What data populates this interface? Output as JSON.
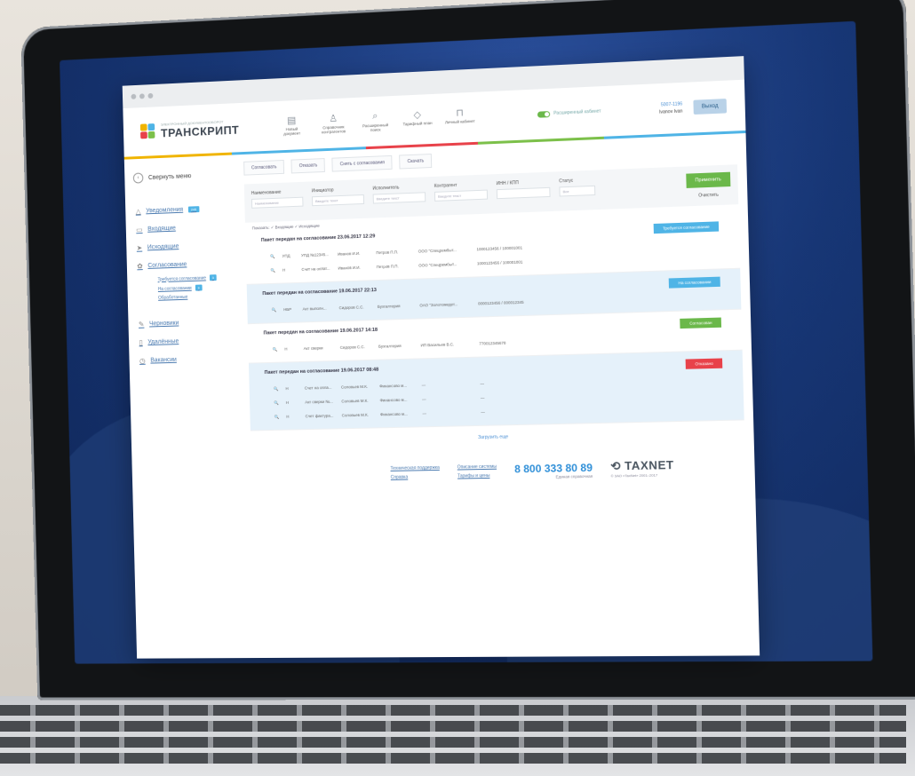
{
  "colors": {
    "accent": "#4fb4e6",
    "green": "#6bb84a",
    "red": "#e8424a"
  },
  "header": {
    "logo_tagline": "ЭЛЕКТРОННЫЙ ДОКУМЕНТООБОРОТ",
    "logo_title": "ТРАНСКРИПТ",
    "tools": [
      {
        "icon": "document-icon",
        "glyph": "▤",
        "label": "Новый документ"
      },
      {
        "icon": "user-icon",
        "glyph": "♙",
        "label": "Справочник контрагентов"
      },
      {
        "icon": "search-icon",
        "glyph": "⌕",
        "label": "Расширенный поиск"
      },
      {
        "icon": "tag-icon",
        "glyph": "◇",
        "label": "Тарифный план"
      },
      {
        "icon": "lock-icon",
        "glyph": "⊓",
        "label": "Личный кабинет"
      }
    ],
    "toggle_label": "Расширенный кабинет",
    "user_id": "5007-1196",
    "user_name": "Ivanov Ivan",
    "exit_label": "Выход"
  },
  "sidebar": {
    "collapse_label": "Свернуть меню",
    "items": [
      {
        "icon": "bell-icon",
        "glyph": "△",
        "label": "Уведомления",
        "badge": "245"
      },
      {
        "icon": "inbox-icon",
        "glyph": "▭",
        "label": "Входящие"
      },
      {
        "icon": "send-icon",
        "glyph": "➤",
        "label": "Исходящие"
      },
      {
        "icon": "gear-icon",
        "glyph": "✿",
        "label": "Согласование"
      }
    ],
    "sub": [
      {
        "label": "Требуется согласование",
        "badge": "3"
      },
      {
        "label": "На согласовании",
        "badge": "3"
      },
      {
        "label": "Обработанные"
      }
    ],
    "items2": [
      {
        "icon": "pen-icon",
        "glyph": "✎",
        "label": "Черновики"
      },
      {
        "icon": "trash-icon",
        "glyph": "▯",
        "label": "Удалённые"
      },
      {
        "icon": "clock-icon",
        "glyph": "◷",
        "label": "Вакансии"
      }
    ]
  },
  "actions": [
    "Согласовать",
    "Отказать",
    "Снять с согласования",
    "Скачать"
  ],
  "filters": {
    "columns": [
      {
        "label": "Наименование",
        "placeholder": "Наименование"
      },
      {
        "label": "Инициатор",
        "placeholder": "Введите текст"
      },
      {
        "label": "Исполнитель",
        "placeholder": "Введите текст"
      },
      {
        "label": "Контрагент",
        "placeholder": "Введите текст"
      },
      {
        "label": "ИНН / КПП",
        "placeholder": ""
      },
      {
        "label": "Статус",
        "placeholder": "Все"
      }
    ],
    "apply": "Применить",
    "clear": "Очистить",
    "show": "Показать:  ✓ Входящие  ✓ Исходящие"
  },
  "packages": [
    {
      "title": "Пакет передан на согласование 23.06.2017 12:29",
      "status": "Требуется согласование",
      "status_color": "#4fb4e6",
      "alt": false,
      "rows": [
        [
          "🔍",
          "УПД",
          "УПД №12345...",
          "Иванов И.И.",
          "Петров П.П.",
          "ООО \"Спецрембыт...",
          "1000123456 / 100001001"
        ],
        [
          "🔍",
          "Н",
          "Счет на оплат...",
          "Иванов И.И.",
          "Петров П.П.",
          "ООО \"Спецрембыт...",
          "1000123456 / 100001001"
        ]
      ]
    },
    {
      "title": "Пакет передан на согласование 19.06.2017 22:13",
      "status": "На согласовании",
      "status_color": "#4fb4e6",
      "alt": true,
      "rows": [
        [
          "🔍",
          "НБР",
          "Акт выполн...",
          "Сидоров С.С.",
          "Бухгалтерия",
          "ОАО \"Золотомедет...",
          "0000123456 / 000012345"
        ]
      ]
    },
    {
      "title": "Пакет передан на согласование 19.06.2017 14:18",
      "status": "Согласован",
      "status_color": "#6bb84a",
      "alt": false,
      "rows": [
        [
          "🔍",
          "Н",
          "Акт сверки",
          "Сидоров С.С.",
          "Бухгалтерия",
          "ИП Васильев В.С.",
          "770012345678"
        ]
      ]
    },
    {
      "title": "Пакет передан на согласование 19.06.2017 08:48",
      "status": "Отказано",
      "status_color": "#e8424a",
      "alt": true,
      "rows": [
        [
          "🔍",
          "Н",
          "Счет на опла...",
          "Соловьев М.К.",
          "Финансово м...",
          "—",
          "—"
        ],
        [
          "🔍",
          "Н",
          "Акт сверки №...",
          "Соловьев М.К.",
          "Финансово м...",
          "—",
          "—"
        ],
        [
          "🔍",
          "Н",
          "Счет фактура...",
          "Соловьев М.К.",
          "Финансово м...",
          "—",
          "—"
        ]
      ]
    }
  ],
  "more": "Загрузить еще",
  "footer": {
    "links1": [
      "Техническая поддержка",
      "Справка"
    ],
    "links2": [
      "Описание системы",
      "Тарифы и цены"
    ],
    "phone": "8 800 333 80 89",
    "phone_sub": "Единая справочная",
    "brand": "TAXNET",
    "copyright": "© ЗАО «TaxNet» 2001–2017"
  }
}
